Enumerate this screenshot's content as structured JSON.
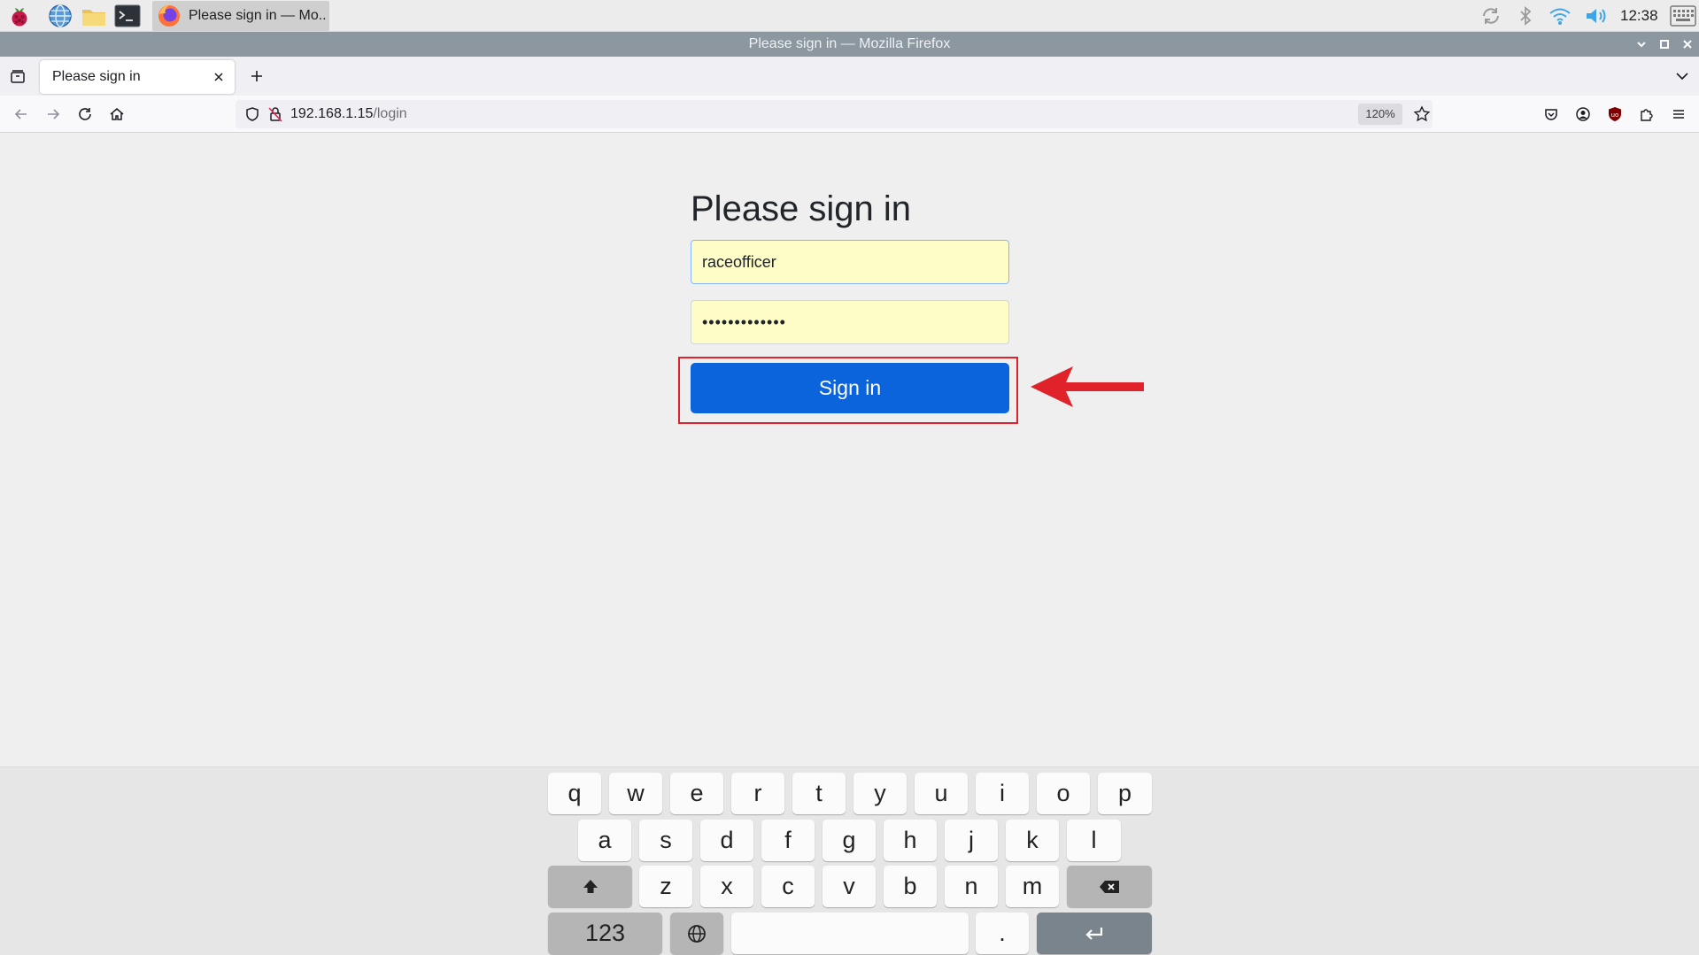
{
  "taskbar": {
    "launchers": [
      {
        "name": "raspberry-menu-icon"
      },
      {
        "name": "web-browser-icon"
      },
      {
        "name": "file-manager-icon"
      },
      {
        "name": "terminal-icon"
      }
    ],
    "task": {
      "label": "Please sign in — Mo..",
      "icon": "firefox-icon"
    },
    "tray": [
      "updates-icon",
      "bluetooth-icon",
      "wifi-icon",
      "volume-icon"
    ],
    "clock": "12:38",
    "keyboard_toggle_icon": "virtual-keyboard-icon"
  },
  "window": {
    "title": "Please sign in — Mozilla Firefox"
  },
  "tabs": {
    "active": {
      "title": "Please sign in"
    }
  },
  "navbar": {
    "url_host": "192.168.1.15",
    "url_path": "/login",
    "zoom": "120%"
  },
  "form": {
    "heading": "Please sign in",
    "username_value": "raceofficer",
    "password_value": "•••••••••••••",
    "submit_label": "Sign in"
  },
  "annotation": {
    "color": "#e0222a"
  },
  "keyboard": {
    "row1": [
      "q",
      "w",
      "e",
      "r",
      "t",
      "y",
      "u",
      "i",
      "o",
      "p"
    ],
    "row2": [
      "a",
      "s",
      "d",
      "f",
      "g",
      "h",
      "j",
      "k",
      "l"
    ],
    "row3": [
      "z",
      "x",
      "c",
      "v",
      "b",
      "n",
      "m"
    ],
    "numbers_label": "123",
    "period_label": "."
  },
  "colors": {
    "accent": "#0b64dc",
    "field_fill": "#fefdc7",
    "titlebar": "#8c979f"
  }
}
